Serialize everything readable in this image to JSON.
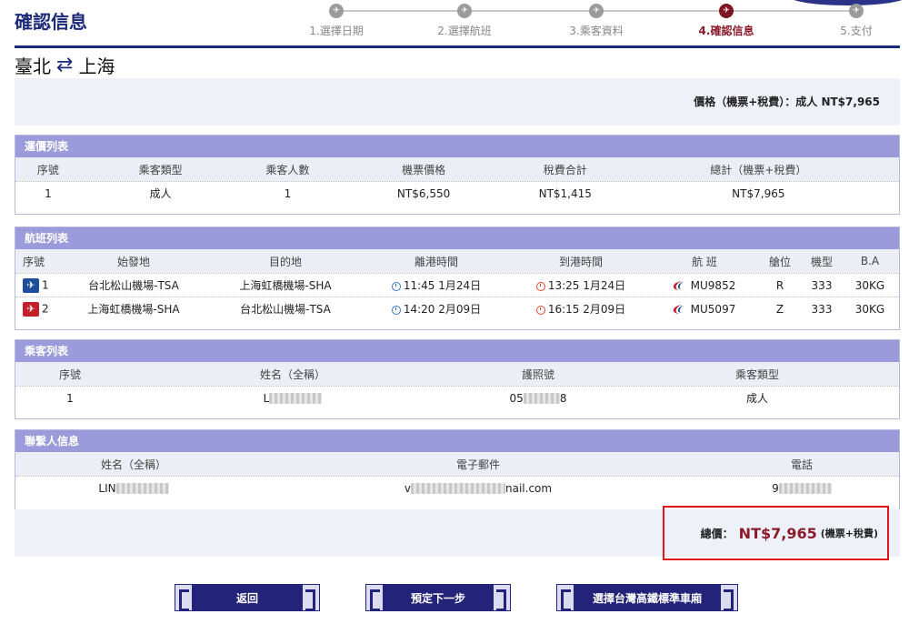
{
  "header": {
    "title": "確認信息",
    "steps": [
      {
        "label": "1.選擇日期",
        "active": false
      },
      {
        "label": "2.選擇航班",
        "active": false
      },
      {
        "label": "3.乘客資料",
        "active": false
      },
      {
        "label": "4.確認信息",
        "active": true
      },
      {
        "label": "5.支付",
        "active": false
      }
    ]
  },
  "route": {
    "from": "臺北",
    "to": "上海"
  },
  "price_summary": {
    "text": "價格（機票+稅費）：成人 NT$7,965"
  },
  "fare_list": {
    "title": "運價列表",
    "columns": [
      "序號",
      "乘客類型",
      "乘客人數",
      "機票價格",
      "稅費合計",
      "總計（機票+稅費）"
    ],
    "rows": [
      [
        "1",
        "成人",
        "1",
        "NT$6,550",
        "NT$1,415",
        "NT$7,965"
      ]
    ]
  },
  "flight_list": {
    "title": "航班列表",
    "columns": [
      "序號",
      "始發地",
      "目的地",
      "離港時間",
      "到港時間",
      "航 班",
      "艙位",
      "機型",
      "B.A"
    ],
    "rows": [
      {
        "no": "1",
        "from": "台北松山機場-TSA",
        "to": "上海虹橋機場-SHA",
        "depart": "11:45 1月24日",
        "arrive": "13:25 1月24日",
        "flight": "MU9852",
        "cabin": "R",
        "aircraft": "333",
        "baggage": "30KG"
      },
      {
        "no": "2",
        "from": "上海虹橋機場-SHA",
        "to": "台北松山機場-TSA",
        "depart": "14:20 2月09日",
        "arrive": "16:15 2月09日",
        "flight": "MU5097",
        "cabin": "Z",
        "aircraft": "333",
        "baggage": "30KG"
      }
    ]
  },
  "passenger_list": {
    "title": "乘客列表",
    "columns": [
      "序號",
      "姓名（全稱）",
      "護照號",
      "乘客類型"
    ],
    "rows": [
      {
        "no": "1",
        "name": "L",
        "passport_start": "05",
        "passport_end": "8",
        "type": "成人"
      }
    ]
  },
  "contact": {
    "title": "聯繫人信息",
    "columns": [
      "姓名（全稱）",
      "電子郵件",
      "電話"
    ],
    "row": {
      "name": "LIN",
      "email_start": "v",
      "email_end": "nail.com",
      "phone": "9"
    }
  },
  "total": {
    "label": "總價：",
    "amount": "NT$7,965",
    "note": "(機票+稅費)"
  },
  "buttons": {
    "back": "返回",
    "next": "預定下一步",
    "rail": "選擇台灣高鐵標準車廂"
  }
}
